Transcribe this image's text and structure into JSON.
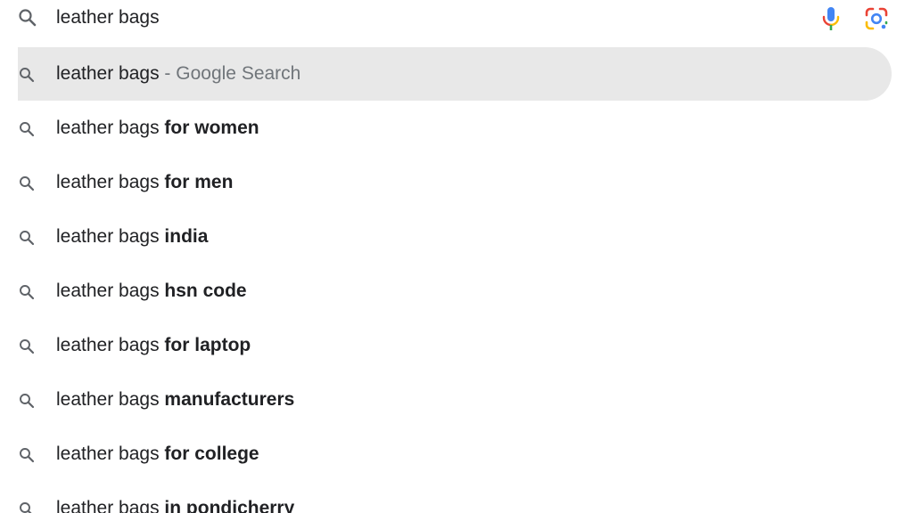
{
  "search": {
    "query": "leather bags",
    "icons": {
      "search": "search-icon",
      "voice": "microphone-icon",
      "lens": "google-lens-icon"
    }
  },
  "colors": {
    "highlight_bg": "#e8e8e8",
    "text": "#202124",
    "muted": "#70757a",
    "mic_blue": "#4285f4",
    "mic_red": "#ea4335",
    "mic_yellow": "#fbbc04",
    "mic_green": "#34a853"
  },
  "suggestions": [
    {
      "base": "leather bags",
      "separator": " - ",
      "source": "Google Search",
      "completion": ""
    },
    {
      "base": "leather bags ",
      "completion": "for women"
    },
    {
      "base": "leather bags ",
      "completion": "for men"
    },
    {
      "base": "leather bags ",
      "completion": "india"
    },
    {
      "base": "leather bags ",
      "completion": "hsn code"
    },
    {
      "base": "leather bags ",
      "completion": "for laptop"
    },
    {
      "base": "leather bags ",
      "completion": "manufacturers"
    },
    {
      "base": "leather bags ",
      "completion": "for college"
    },
    {
      "base": "leather bags ",
      "completion": "in pondicherry"
    }
  ]
}
